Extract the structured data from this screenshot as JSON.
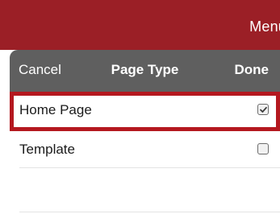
{
  "app_bar": {
    "menu_label": "Menu",
    "background": "#9b1f26"
  },
  "sheet": {
    "header": {
      "cancel_label": "Cancel",
      "title": "Page Type",
      "done_label": "Done",
      "background": "#5f5f5f"
    },
    "options": [
      {
        "label": "Home Page",
        "checked": true,
        "highlighted": true
      },
      {
        "label": "Template",
        "checked": false,
        "highlighted": false
      },
      {
        "label": "",
        "checked": false,
        "highlighted": false
      }
    ]
  },
  "colors": {
    "accent": "#b4181f",
    "brand": "#9b1f26"
  },
  "icons": {
    "checked": "checkbox-checked-icon",
    "unchecked": "checkbox-unchecked-icon"
  }
}
